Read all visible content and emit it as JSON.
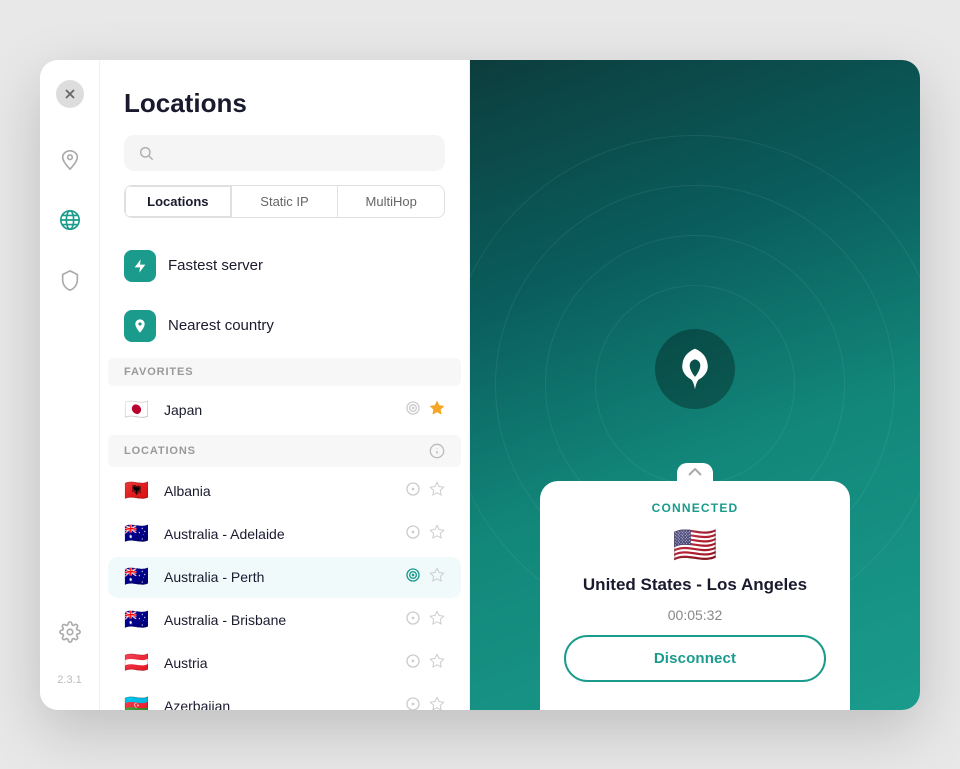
{
  "app": {
    "version": "2.3.1"
  },
  "sidebar": {
    "icons": [
      {
        "name": "close-icon",
        "label": "Close"
      },
      {
        "name": "leaf-icon",
        "label": "VPN"
      },
      {
        "name": "globe-icon",
        "label": "Locations",
        "active": true
      },
      {
        "name": "shield-icon",
        "label": "Security"
      },
      {
        "name": "gear-icon",
        "label": "Settings"
      }
    ]
  },
  "locations": {
    "title": "Locations",
    "search_placeholder": "",
    "tabs": [
      {
        "label": "Locations",
        "active": true
      },
      {
        "label": "Static IP",
        "active": false
      },
      {
        "label": "MultiHop",
        "active": false
      }
    ],
    "quick_items": [
      {
        "label": "Fastest server",
        "icon": "bolt"
      },
      {
        "label": "Nearest country",
        "icon": "pin"
      }
    ],
    "sections": {
      "favorites": {
        "header": "FAVORITES",
        "items": [
          {
            "name": "Japan",
            "flag": "🇯🇵",
            "favorited": true
          }
        ]
      },
      "locations": {
        "header": "LOCATIONS",
        "items": [
          {
            "name": "Albania",
            "flag": "🇦🇱",
            "highlighted": false
          },
          {
            "name": "Australia - Adelaide",
            "flag": "🇦🇺",
            "highlighted": false
          },
          {
            "name": "Australia - Perth",
            "flag": "🇦🇺",
            "highlighted": true
          },
          {
            "name": "Australia - Brisbane",
            "flag": "🇦🇺",
            "highlighted": false
          },
          {
            "name": "Austria",
            "flag": "🇦🇹",
            "highlighted": false
          },
          {
            "name": "Azerbaijan",
            "flag": "🇦🇿",
            "highlighted": false
          }
        ]
      }
    }
  },
  "vpn": {
    "status": "CONNECTED",
    "country": "United States - Los Angeles",
    "flag": "🇺🇸",
    "time": "00:05:32",
    "disconnect_label": "Disconnect"
  }
}
